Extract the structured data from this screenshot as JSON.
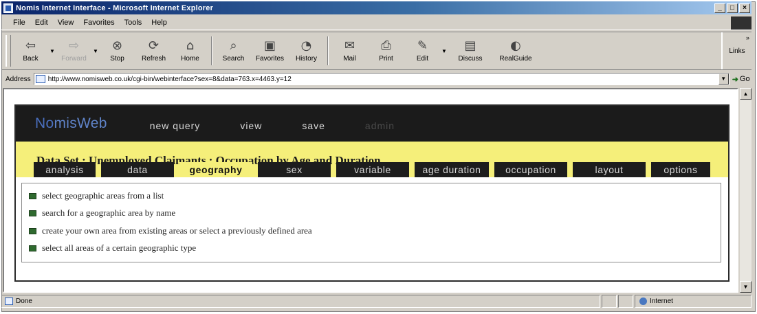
{
  "window": {
    "title": "Nomis Internet Interface - Microsoft Internet Explorer",
    "controls": [
      "_",
      "□",
      "×"
    ]
  },
  "menu": {
    "items": [
      "File",
      "Edit",
      "View",
      "Favorites",
      "Tools",
      "Help"
    ]
  },
  "toolbar": {
    "back": "Back",
    "forward": "Forward",
    "stop": "Stop",
    "refresh": "Refresh",
    "home": "Home",
    "search": "Search",
    "favorites": "Favorites",
    "history": "History",
    "mail": "Mail",
    "print": "Print",
    "edit": "Edit",
    "discuss": "Discuss",
    "realguide": "RealGuide",
    "links": "Links"
  },
  "address": {
    "label": "Address",
    "url": "http://www.nomisweb.co.uk/cgi-bin/webinterface?sex=8&data=763.x=4463.y=12",
    "go": "Go"
  },
  "page": {
    "logo_prefix": "No",
    "logo_rest": "misWeb",
    "nav": [
      "new query",
      "view",
      "save",
      "admin"
    ],
    "dataset_title": "Data Set : Unemployed Claimants : Occupation by Age and Duration",
    "tabs": [
      "analysis",
      "data",
      "geography",
      "sex",
      "variable",
      "age duration",
      "occupation",
      "layout",
      "options"
    ],
    "active_tab": "geography",
    "options": [
      "select geographic areas from a list",
      "search for a geographic area by name",
      "create your own area from existing areas or select a previously defined area",
      "select all areas of a certain geographic type"
    ]
  },
  "status": {
    "text": "Done",
    "zone": "Internet"
  }
}
